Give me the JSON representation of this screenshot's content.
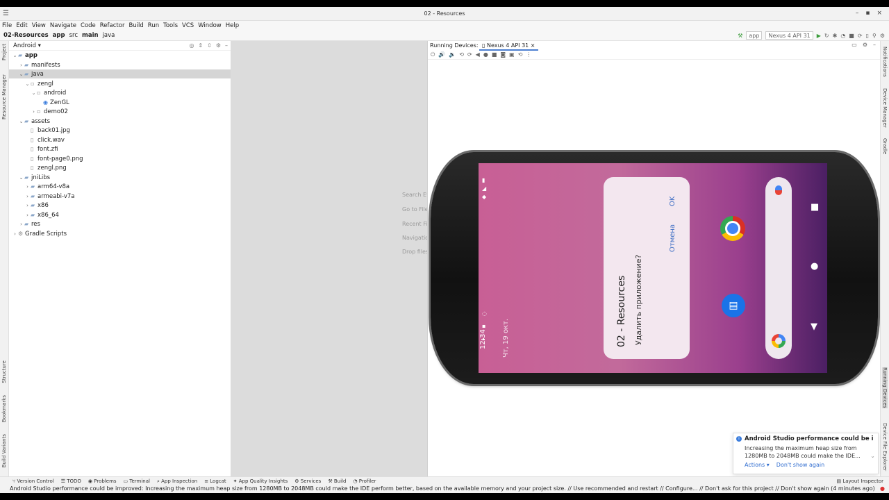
{
  "window": {
    "title": "02 - Resources"
  },
  "menu": [
    "File",
    "Edit",
    "View",
    "Navigate",
    "Code",
    "Refactor",
    "Build",
    "Run",
    "Tools",
    "VCS",
    "Window",
    "Help"
  ],
  "breadcrumb": [
    "02-Resources",
    "app",
    "src",
    "main",
    "java"
  ],
  "run_config": {
    "module": "app",
    "device": "Nexus 4 API 31"
  },
  "project": {
    "view": "Android",
    "tree": [
      {
        "label": "app",
        "depth": 0,
        "arrow": "v",
        "icon": "folder",
        "bold": true
      },
      {
        "label": "manifests",
        "depth": 1,
        "arrow": ">",
        "icon": "folder"
      },
      {
        "label": "java",
        "depth": 1,
        "arrow": "v",
        "icon": "folder",
        "selected": true
      },
      {
        "label": "zengl",
        "depth": 2,
        "arrow": "v",
        "icon": "package"
      },
      {
        "label": "android",
        "depth": 3,
        "arrow": "v",
        "icon": "package"
      },
      {
        "label": "ZenGL",
        "depth": 4,
        "arrow": "",
        "icon": "class"
      },
      {
        "label": "demo02",
        "depth": 3,
        "arrow": ">",
        "icon": "package"
      },
      {
        "label": "assets",
        "depth": 1,
        "arrow": "v",
        "icon": "folder"
      },
      {
        "label": "back01.jpg",
        "depth": 2,
        "arrow": "",
        "icon": "file"
      },
      {
        "label": "click.wav",
        "depth": 2,
        "arrow": "",
        "icon": "file"
      },
      {
        "label": "font.zfi",
        "depth": 2,
        "arrow": "",
        "icon": "file"
      },
      {
        "label": "font-page0.png",
        "depth": 2,
        "arrow": "",
        "icon": "file"
      },
      {
        "label": "zengl.png",
        "depth": 2,
        "arrow": "",
        "icon": "file"
      },
      {
        "label": "jniLibs",
        "depth": 1,
        "arrow": "v",
        "icon": "folder"
      },
      {
        "label": "arm64-v8a",
        "depth": 2,
        "arrow": ">",
        "icon": "folder"
      },
      {
        "label": "armeabi-v7a",
        "depth": 2,
        "arrow": ">",
        "icon": "folder"
      },
      {
        "label": "x86",
        "depth": 2,
        "arrow": ">",
        "icon": "folder"
      },
      {
        "label": "x86_64",
        "depth": 2,
        "arrow": ">",
        "icon": "folder"
      },
      {
        "label": "res",
        "depth": 1,
        "arrow": ">",
        "icon": "folder"
      },
      {
        "label": "Gradle Scripts",
        "depth": 0,
        "arrow": ">",
        "icon": "gradle"
      }
    ]
  },
  "editor_hints": [
    "Search Ev",
    "Go to File",
    "Recent Fil",
    "Navigatio",
    "Drop files"
  ],
  "running_devices": {
    "label": "Running Devices:",
    "tab": "Nexus 4 API 31"
  },
  "emulator": {
    "clock": "12:34",
    "date": "Чт, 19 окт.",
    "dialog_title": "02 - Resources",
    "dialog_message": "Удалить приложение?",
    "ok": "OK",
    "cancel": "Отмена"
  },
  "left_tools": [
    "Project",
    "Resource Manager",
    "Structure",
    "Bookmarks",
    "Build Variants"
  ],
  "right_tools": [
    "Notifications",
    "Device Manager",
    "Gradle",
    "Running Devices",
    "Device File Explorer"
  ],
  "notification": {
    "title": "Android Studio performance could be improv",
    "body": "Increasing the maximum heap size from 1280MB to 2048MB could make the IDE...",
    "action1": "Actions",
    "action2": "Don't show again"
  },
  "bottom_tools": [
    "Version Control",
    "TODO",
    "Problems",
    "Terminal",
    "App Inspection",
    "Logcat",
    "App Quality Insights",
    "Services",
    "Build",
    "Profiler"
  ],
  "layout_inspector": "Layout Inspector",
  "status": "Android Studio performance could be improved: Increasing the maximum heap size from 1280MB to 2048MB could make the IDE perform better, based on the available memory and your project size. // Use recommended and restart // Configure... // Don't ask for this project // Don't show again (4 minutes ago)"
}
